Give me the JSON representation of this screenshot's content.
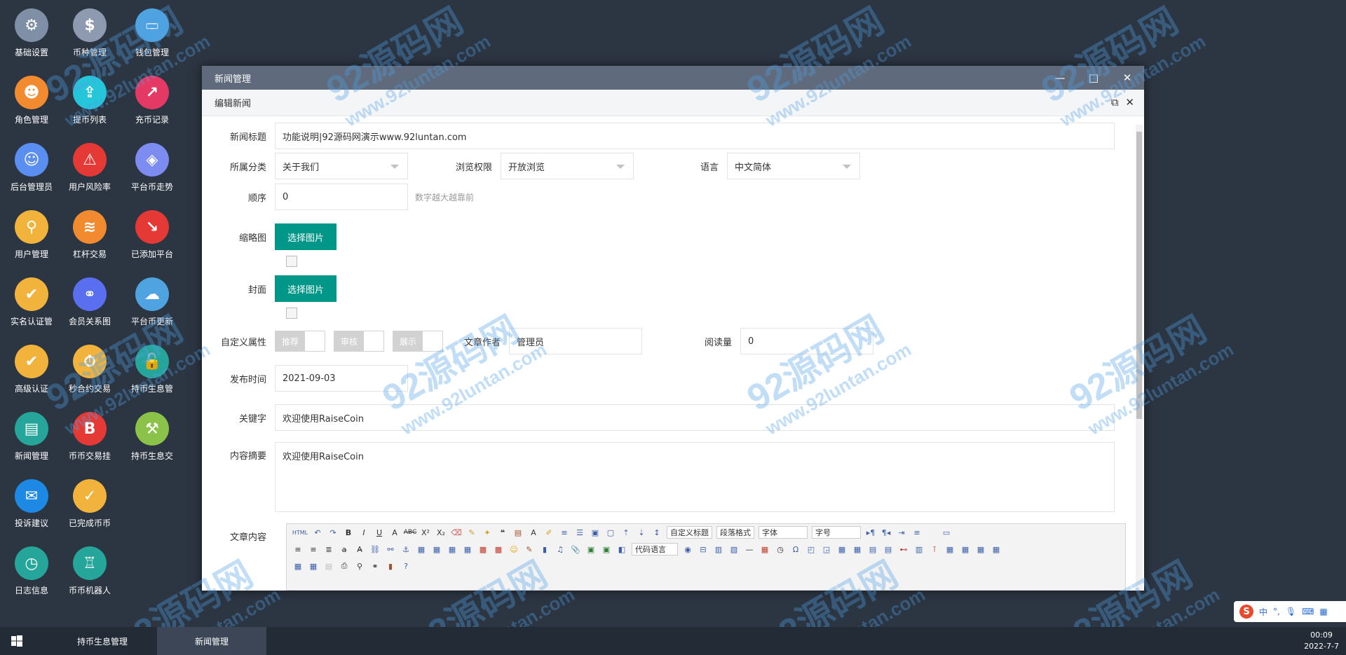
{
  "desktop": {
    "col1": [
      {
        "label": "基础设置",
        "icon": "gear-icon",
        "color": "#7f8fa6"
      },
      {
        "label": "角色管理",
        "icon": "roles-icon",
        "color": "#f28b30"
      },
      {
        "label": "后台管理员",
        "icon": "admin-icon",
        "color": "#5a8ef0"
      },
      {
        "label": "用户管理",
        "icon": "user-search-icon",
        "color": "#f2b33d"
      },
      {
        "label": "实名认证管",
        "icon": "verify-icon",
        "color": "#f2b33d"
      },
      {
        "label": "高级认证",
        "icon": "advanced-verify-icon",
        "color": "#f2b33d"
      },
      {
        "label": "新闻管理",
        "icon": "news-icon",
        "color": "#26a69a"
      },
      {
        "label": "投诉建议",
        "icon": "feedback-icon",
        "color": "#1e88e5"
      },
      {
        "label": "日志信息",
        "icon": "log-icon",
        "color": "#26a69a"
      }
    ],
    "col2": [
      {
        "label": "币种管理",
        "icon": "dollar-icon",
        "color": "#8e9aaf"
      },
      {
        "label": "提币列表",
        "icon": "withdraw-icon",
        "color": "#26c6da"
      },
      {
        "label": "用户风险率",
        "icon": "alarm-icon",
        "color": "#e53935"
      },
      {
        "label": "杠杆交易",
        "icon": "layers-icon",
        "color": "#f28b30"
      },
      {
        "label": "会员关系图",
        "icon": "network-icon",
        "color": "#5a6ef0"
      },
      {
        "label": "秒合约交易",
        "icon": "stopwatch-icon",
        "color": "#f2b33d"
      },
      {
        "label": "币币交易挂",
        "icon": "bitcoin-icon",
        "color": "#e53935"
      },
      {
        "label": "已完成币币",
        "icon": "check-icon",
        "color": "#f2b33d"
      },
      {
        "label": "币币机器人",
        "icon": "robot-icon",
        "color": "#26a69a"
      }
    ],
    "col3": [
      {
        "label": "钱包管理",
        "icon": "wallet-icon",
        "color": "#4fa3e0"
      },
      {
        "label": "充币记录",
        "icon": "deposit-chart-icon",
        "color": "#e53965"
      },
      {
        "label": "平台币走势",
        "icon": "stack-icon",
        "color": "#7c8cf0"
      },
      {
        "label": "已添加平台",
        "icon": "trend-icon",
        "color": "#e53935"
      },
      {
        "label": "平台币更新",
        "icon": "cloud-refresh-icon",
        "color": "#4fa3e0"
      },
      {
        "label": "持币生息管",
        "icon": "unlock-icon",
        "color": "#26a69a"
      },
      {
        "label": "持币生息交",
        "icon": "hammer-icon",
        "color": "#8bc34a"
      }
    ]
  },
  "window": {
    "title": "新闻管理",
    "subtitle": "编辑新闻",
    "minimize": "—",
    "maximize": "□",
    "close": "✕",
    "sub_restore": "⧉",
    "sub_close": "✕"
  },
  "form": {
    "title_label": "新闻标题",
    "title_value": "功能说明|92源码网演示www.92luntan.com",
    "category_label": "所属分类",
    "category_value": "关于我们",
    "permission_label": "浏览权限",
    "permission_value": "开放浏览",
    "language_label": "语言",
    "language_value": "中文简体",
    "order_label": "顺序",
    "order_value": "0",
    "order_hint": "数字越大越靠前",
    "thumb_label": "缩略图",
    "thumb_button": "选择图片",
    "cover_label": "封面",
    "cover_button": "选择图片",
    "custom_label": "自定义属性",
    "switch_recommend": "推荐",
    "switch_audit": "审核",
    "switch_show": "展示",
    "author_label": "文章作者",
    "author_value": "管理员",
    "reads_label": "阅读量",
    "reads_value": "0",
    "date_label": "发布时间",
    "date_value": "2021-09-03",
    "keywords_label": "关键字",
    "keywords_value": "欢迎使用RaiseCoin",
    "summary_label": "内容摘要",
    "summary_value": "欢迎使用RaiseCoin",
    "content_label": "文章内容"
  },
  "editor": {
    "html_btn": "HTML",
    "dd_custom_title": "自定义标题",
    "dd_paragraph": "段落格式",
    "dd_font": "字体",
    "dd_size": "字号",
    "dd_code": "代码语言"
  },
  "taskbar": {
    "task1": "持币生息管理",
    "task2": "新闻管理",
    "time": "00:09",
    "date": "2022-7-7"
  },
  "ime": {
    "logo": "S",
    "mode": "中"
  },
  "watermark": {
    "main": "92源码网",
    "url": "www.92luntan.com"
  },
  "colors": {
    "teal": "#009688",
    "titlebar": "#5f6b7c",
    "desktop": "#2c3542"
  }
}
